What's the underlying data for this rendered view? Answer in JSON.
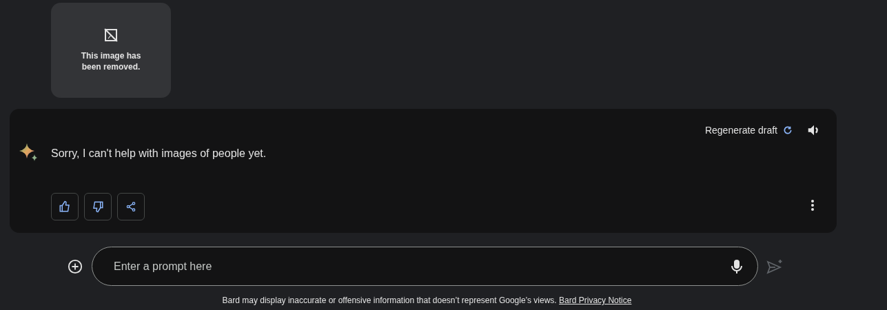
{
  "removed_image": {
    "text": "This image has been removed."
  },
  "response": {
    "regenerate_label": "Regenerate draft",
    "message": "Sorry, I can't help with images of people yet."
  },
  "prompt": {
    "placeholder": "Enter a prompt here",
    "send_disabled": true
  },
  "footer": {
    "text": "Bard may display inaccurate or offensive information that doesn’t represent Google’s views.",
    "link": "Bard Privacy Notice"
  }
}
